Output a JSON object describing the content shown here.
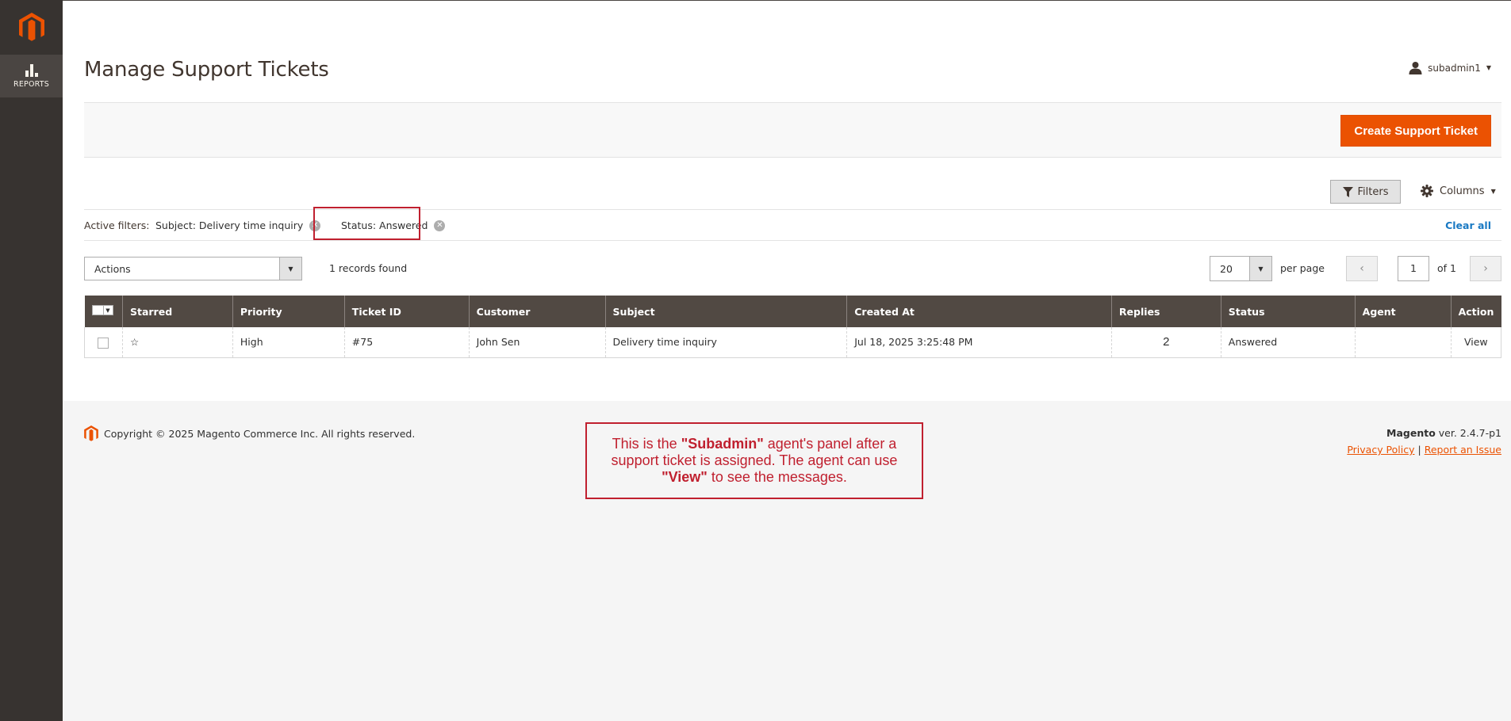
{
  "sidebar": {
    "nav": [
      {
        "label": "REPORTS",
        "icon": "bar-chart-icon"
      }
    ]
  },
  "header": {
    "title": "Manage Support Tickets",
    "user": "subadmin1"
  },
  "actions": {
    "create_label": "Create Support Ticket"
  },
  "toolbar": {
    "filters_label": "Filters",
    "columns_label": "Columns"
  },
  "active_filters": {
    "label": "Active filters:",
    "chips": [
      {
        "label": "Subject: Delivery time inquiry"
      },
      {
        "label": "Status: Answered"
      }
    ],
    "clear_all": "Clear all"
  },
  "grid_controls": {
    "mass_action": "Actions",
    "records_found": "1 records found",
    "per_page_value": "20",
    "per_page_label": "per page",
    "current_page": "1",
    "of_pages": "of 1"
  },
  "table": {
    "columns": [
      "Starred",
      "Priority",
      "Ticket ID",
      "Customer",
      "Subject",
      "Created At",
      "Replies",
      "Status",
      "Agent",
      "Action"
    ],
    "rows": [
      {
        "starred": "☆",
        "priority": "High",
        "ticket_id": "#75",
        "customer": "John Sen",
        "subject": "Delivery time inquiry",
        "created_at": "Jul 18, 2025 3:25:48 PM",
        "replies": "2",
        "status": "Answered",
        "agent": "",
        "action": "View"
      }
    ]
  },
  "footer": {
    "copyright": "Copyright © 2025 Magento Commerce Inc. All rights reserved.",
    "brand": "Magento",
    "version": " ver. 2.4.7-p1",
    "privacy": "Privacy Policy",
    "separator": "|",
    "report_issue": "Report an Issue"
  },
  "annotation": {
    "part1": "This is the ",
    "bold1": "\"Subadmin\"",
    "part2": " agent's panel after a support ticket is assigned. The agent can use ",
    "bold2": "\"View\"",
    "part3": " to see the messages."
  },
  "colors": {
    "accent": "#eb5202",
    "sidebar": "#373330",
    "table_header": "#514943",
    "link": "#1979c3",
    "annotation": "#c0202f"
  }
}
